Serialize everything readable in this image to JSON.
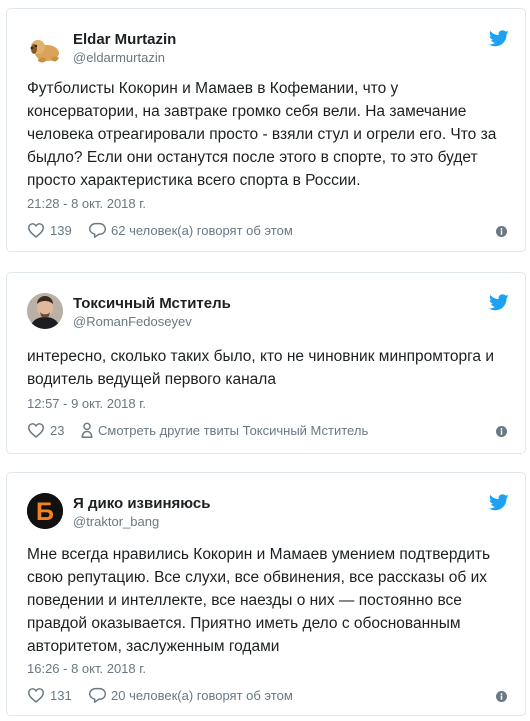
{
  "tweets": [
    {
      "author_name": "Eldar Murtazin",
      "handle": "@eldarmurtazin",
      "text": "Футболисты Кокорин и Мамаев в Кофемании, что у консерватории, на завтраке громко себя вели. На замечание человека отреагировали просто - взяли стул и огрели его. Что за быдло? Если они останутся после этого в спорте, то это будет просто характеристика всего спорта в России.",
      "timestamp": "21:28 - 8 окт. 2018 г.",
      "likes": "139",
      "secondary_action": "62 человек(а) говорят об этом",
      "avatar": "puppy-toy-avatar"
    },
    {
      "author_name": "Токсичный Мститель",
      "handle": "@RomanFedoseyev",
      "text": "интересно, сколько таких было, кто не чиновник минпромторга и водитель ведущей первого канала",
      "timestamp": "12:57 - 9 окт. 2018 г.",
      "likes": "23",
      "secondary_action": "Смотреть другие твиты Токсичный Мститель",
      "avatar": "man-portrait-avatar"
    },
    {
      "author_name": "Я дико извиняюсь",
      "handle": "@traktor_bang",
      "text": "Мне всегда нравились Кокорин и Мамаев умением подтвердить свою репутацию. Все слухи, все обвинения, все рассказы об их поведении и интеллекте, все наезды о них — постоянно все правдой оказывается. Приятно иметь дело с обоснованным авторитетом, заслуженным годами",
      "timestamp": "16:26 - 8 окт. 2018 г.",
      "likes": "131",
      "secondary_action": "20 человек(а) говорят об этом",
      "avatar": "orange-letter-b-avatar",
      "avatar_letter": "Б"
    }
  ],
  "icons": {
    "brand": "twitter-bird-icon",
    "like": "heart-icon",
    "comment": "speech-bubble-icon",
    "profile": "person-icon",
    "info": "info-icon"
  },
  "colors": {
    "twitter_blue": "#1da1f2",
    "muted_text": "#697882",
    "border": "#e1e8ed",
    "avatar_orange": "#f58220"
  }
}
